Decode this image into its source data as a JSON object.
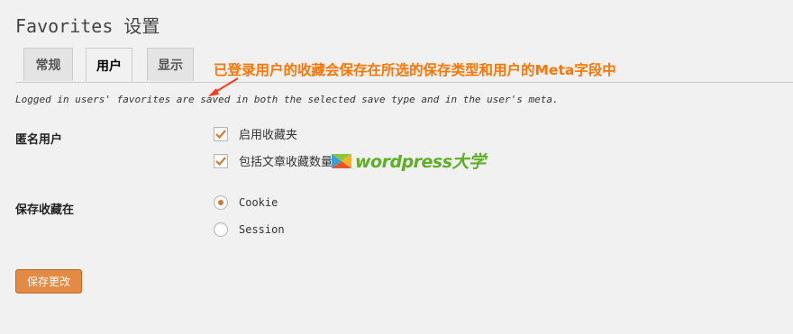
{
  "page": {
    "title": "Favorites 设置"
  },
  "tabs": [
    {
      "label": "常规",
      "active": false
    },
    {
      "label": "用户",
      "active": true
    },
    {
      "label": "显示",
      "active": false
    }
  ],
  "annotation": {
    "text": "已登录用户的收藏会保存在所选的保存类型和用户的Meta字段中",
    "color": "#ff7500"
  },
  "description": "Logged in users' favorites are saved in both the selected save type and in the user's meta.",
  "anonymous": {
    "label": "匿名用户",
    "options": [
      {
        "label": "启用收藏夹",
        "checked": true
      },
      {
        "label": "包括文章收藏数量",
        "checked": true
      }
    ]
  },
  "save_location": {
    "label": "保存收藏在",
    "options": [
      {
        "label": "Cookie",
        "selected": true
      },
      {
        "label": "Session",
        "selected": false
      }
    ]
  },
  "watermark": {
    "text": "wordpress大学"
  },
  "submit": {
    "label": "保存更改"
  },
  "colors": {
    "accent": "#e38b44",
    "checkmark": "#d87a2c",
    "watermark": "#5fae27"
  }
}
